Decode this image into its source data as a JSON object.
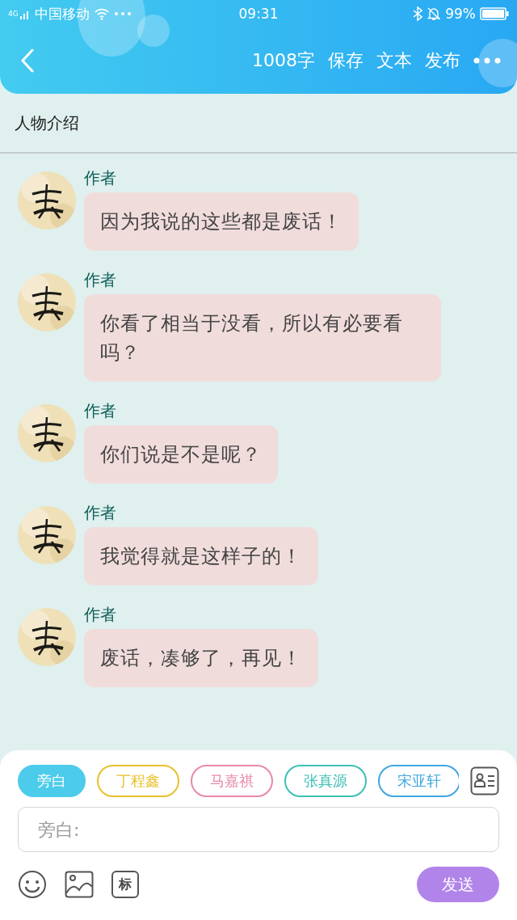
{
  "status_bar": {
    "network": "4G",
    "carrier": "中国移动",
    "time": "09:31",
    "battery": "99%"
  },
  "header": {
    "word_count": "1008字",
    "actions": [
      "保存",
      "文本",
      "发布"
    ]
  },
  "section_title": "人物介绍",
  "messages": [
    {
      "sender": "作者",
      "text": "因为我说的这些都是废话！"
    },
    {
      "sender": "作者",
      "text": "你看了相当于没看，所以有必要看吗？"
    },
    {
      "sender": "作者",
      "text": "你们说是不是呢？"
    },
    {
      "sender": "作者",
      "text": "我觉得就是这样子的！"
    },
    {
      "sender": "作者",
      "text": "废话，凑够了，再见！"
    }
  ],
  "composer": {
    "roles": [
      {
        "label": "旁白",
        "color": "#4ccbeb",
        "selected": true
      },
      {
        "label": "丁程鑫",
        "color": "#e8c12e",
        "selected": false
      },
      {
        "label": "马嘉祺",
        "color": "#e889a6",
        "selected": false
      },
      {
        "label": "张真源",
        "color": "#3cc0b4",
        "selected": false
      },
      {
        "label": "宋亚轩",
        "color": "#3fa6e0",
        "selected": false
      }
    ],
    "placeholder": "旁白:",
    "tag_button": "标",
    "send_button": "发送"
  }
}
